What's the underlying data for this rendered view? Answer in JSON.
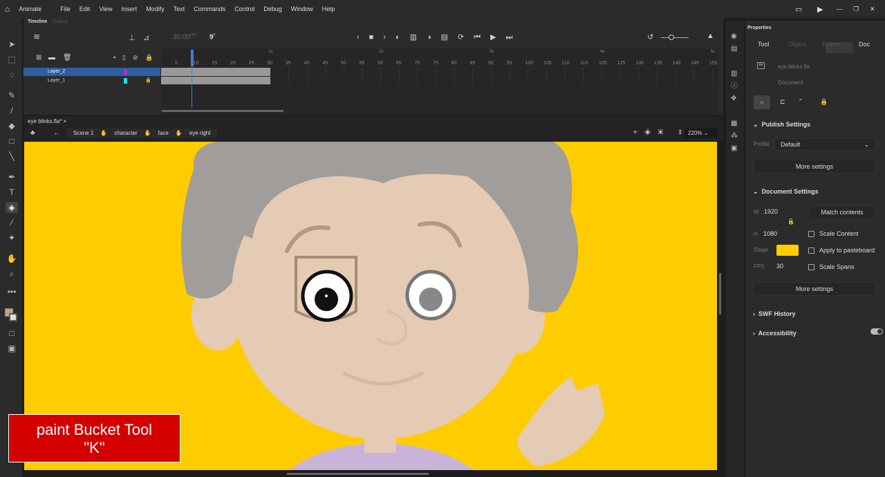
{
  "app": {
    "name": "Animate"
  },
  "menu": [
    "File",
    "Edit",
    "View",
    "Insert",
    "Modify",
    "Text",
    "Commands",
    "Control",
    "Debug",
    "Window",
    "Help"
  ],
  "timeline": {
    "tabs": [
      "Timeline",
      "Output"
    ],
    "fps": "30.00",
    "fps_unit": "FPS",
    "frame": "9",
    "frame_unit": "F",
    "layers": [
      {
        "name": "Layer_2",
        "color": "#b02fc8",
        "selected": true
      },
      {
        "name": "Layer_1",
        "color": "#19e0e0",
        "locked": true
      }
    ],
    "ticks": [
      "5",
      "10",
      "15",
      "20",
      "25",
      "30",
      "35",
      "40",
      "45",
      "50",
      "55",
      "60",
      "65",
      "70",
      "75",
      "80",
      "85",
      "90",
      "95",
      "100",
      "105",
      "110",
      "115",
      "120",
      "125",
      "130",
      "135",
      "140",
      "145",
      "150",
      "155"
    ],
    "seconds": [
      "1s",
      "2s",
      "3s",
      "4s",
      "5s"
    ]
  },
  "document": {
    "tab": "eye blinks.fla*",
    "breadcrumb": [
      "Scene 1",
      "character",
      "face",
      "eye right"
    ],
    "zoom": "220%",
    "stage_color": "#ffcc00"
  },
  "properties": {
    "title": "Properties",
    "tabs": [
      "Tool",
      "Object",
      "Frame",
      "Doc"
    ],
    "active_tab": "Doc",
    "file": "eye blinks.fla",
    "type": "Document",
    "publish": {
      "header": "Publish Settings",
      "profile_label": "Profile",
      "profile": "Default",
      "more": "More settings"
    },
    "doc_settings": {
      "header": "Document Settings",
      "w_label": "W",
      "w": "1920",
      "h_label": "H",
      "h": "1080",
      "stage_label": "Stage",
      "fps_label": "FPS",
      "fps": "30",
      "match": "Match contents",
      "scale_content": "Scale Content",
      "apply_pasteboard": "Apply to pasteboard",
      "scale_spans": "Scale Spans",
      "more": "More settings"
    },
    "swf": "SWF History",
    "accessibility": "Accessibility"
  },
  "caption": {
    "line1": "paint Bucket Tool",
    "line2": "\"K\""
  }
}
